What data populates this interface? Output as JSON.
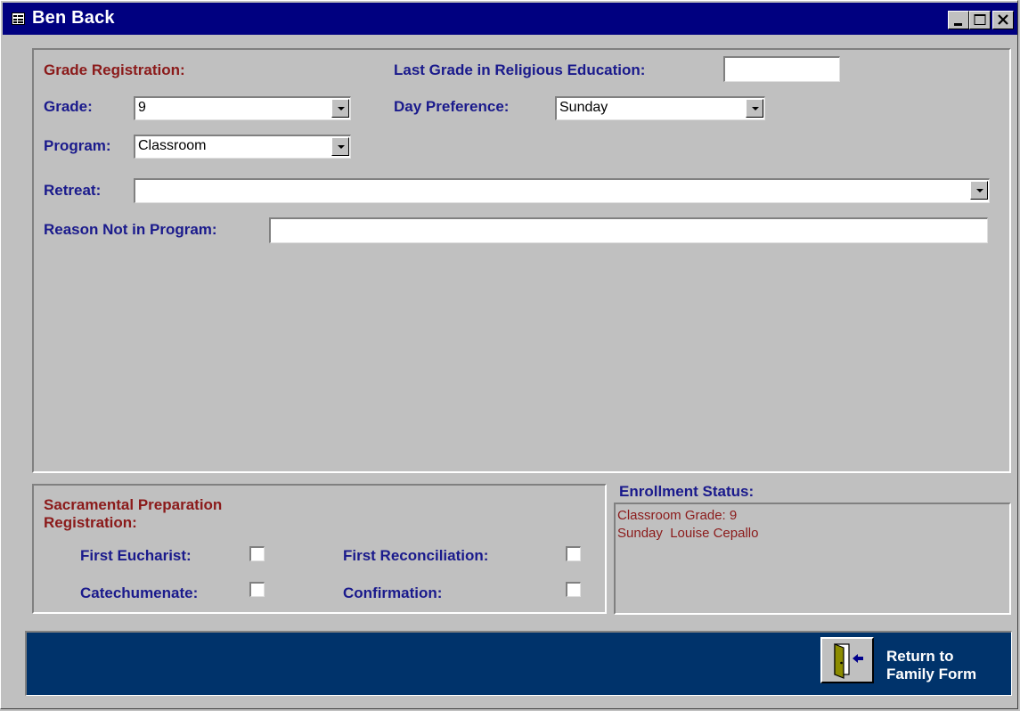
{
  "window": {
    "title": "Ben Back"
  },
  "grade_registration": {
    "heading": "Grade Registration:",
    "grade_label": "Grade:",
    "grade_value": "9",
    "program_label": "Program:",
    "program_value": "Classroom",
    "last_grade_label": "Last Grade in Religious Education:",
    "last_grade_value": "",
    "day_pref_label": "Day Preference:",
    "day_pref_value": "Sunday",
    "retreat_label": "Retreat:",
    "retreat_value": "",
    "reason_label": "Reason Not in Program:",
    "reason_value": ""
  },
  "sacramental": {
    "heading_line1": "Sacramental Preparation",
    "heading_line2": "Registration:",
    "first_eucharist_label": "First Eucharist:",
    "first_reconciliation_label": "First Reconciliation:",
    "catechumenate_label": "Catechumenate:",
    "confirmation_label": "Confirmation:"
  },
  "enrollment": {
    "heading": "Enrollment Status:",
    "line1": "Classroom Grade: 9",
    "line2": "Sunday  Louise Cepallo"
  },
  "footer": {
    "return_line1": "Return to",
    "return_line2": "Family Form"
  },
  "icons": {
    "title": "form-icon",
    "exit": "door-exit-icon"
  },
  "colors": {
    "title_bar": "#000080",
    "label_blue": "#1a1a8c",
    "label_red": "#8b1a1a",
    "footer": "#00336b"
  }
}
